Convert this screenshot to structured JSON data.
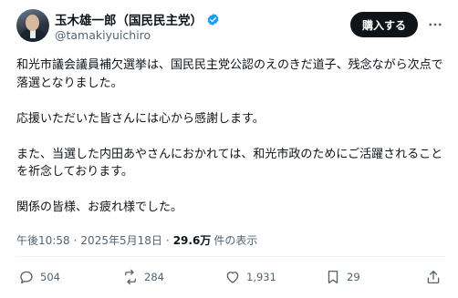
{
  "author": {
    "display_name": "玉木雄一郎（国民民主党）",
    "handle": "@tamakiyuichiro"
  },
  "buy_button": "購入する",
  "post": {
    "paragraphs": [
      "和光市議会議員補欠選挙は、国民民主党公認のえのきだ道子、残念ながら次点で落選となりました。",
      "応援いただいた皆さんには心から感謝します。",
      "また、当選した内田あやさんにおかれては、和光市政のためにご活躍されることを祈念しております。",
      "関係の皆様、お疲れ様でした。"
    ]
  },
  "meta": {
    "time": "午後10:58",
    "separator": "·",
    "date": "2025年5月18日",
    "views_count": "29.6万",
    "views_label": "件の表示"
  },
  "actions": {
    "replies": "504",
    "reposts": "284",
    "likes": "1,931",
    "bookmarks": "29"
  },
  "colors": {
    "text": "#0f1419",
    "secondary": "#536471",
    "verified": "#1d9bf0",
    "button": "#0f1419"
  },
  "icons": [
    "verified-badge-icon",
    "more-icon",
    "reply-icon",
    "repost-icon",
    "like-icon",
    "bookmark-icon",
    "share-icon"
  ]
}
